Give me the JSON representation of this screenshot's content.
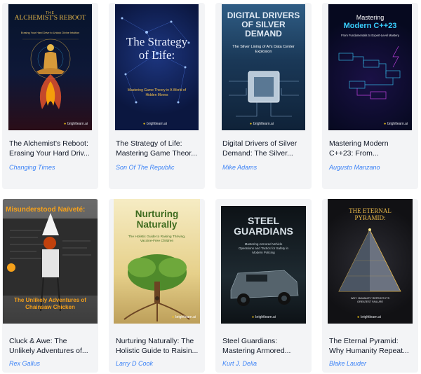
{
  "books": [
    {
      "title_l1": "The Alchemist's Reboot:",
      "title_l2": "Erasing Your Hard Driv...",
      "author": "Changing Times",
      "cover": {
        "top": "THE",
        "main": "ALCHEMIST'S REBOOT",
        "sub": "Erasing Your Hard Drive to Unlock Divine Intuition",
        "brand": "brightlearn.ai",
        "colors": {
          "bg1": "#07142b",
          "bg2": "#1c0d24",
          "accent": "#e9b949",
          "fire": "#e2512b"
        }
      }
    },
    {
      "title_l1": "The Strategy of Life:",
      "title_l2": "Mastering Game Theor...",
      "author": "Son Of The Republic",
      "cover": {
        "main": "The Strategy of Life:",
        "sub": "Mastering Game Theory in A World of Hidden Moves",
        "brand": "brightlearn.ai",
        "colors": {
          "bg1": "#0b1740",
          "bg2": "#11255e",
          "accent": "#f5c24a"
        }
      }
    },
    {
      "title_l1": "Digital Drivers of Silver",
      "title_l2": "Demand: The Silver...",
      "author": "Mike Adams",
      "cover": {
        "main": "DIGITAL DRIVERS OF SILVER DEMAND",
        "sub": "The Silver Lining of AI's Data Center Explosion",
        "brand": "brightlearn.ai",
        "colors": {
          "bg1": "#0f2238",
          "bg2": "#2f5d85",
          "accent": "#c7d8ea"
        }
      }
    },
    {
      "title_l1": "Mastering Modern",
      "title_l2": "C++23: From...",
      "author": "Augusto Manzano",
      "cover": {
        "top": "Mastering",
        "main": "Modern C++23",
        "sub": "From Fundamentals to Expert-Level Mastery",
        "brand": "brightlearn.ai",
        "colors": {
          "bg1": "#06091f",
          "bg2": "#1a1146",
          "accent": "#39d0ff",
          "accent2": "#e04bff"
        }
      }
    },
    {
      "title_l1": "Cluck & Awe: The",
      "title_l2": "Unlikely Adventures of...",
      "author": "Rex Gallus",
      "cover": {
        "main": "Misunderstood Naïveté:",
        "sub": "The Unlikely Adventures of Chainsaw Chicken",
        "colors": {
          "bg1": "#2d2d2d",
          "bg2": "#6b6b6b",
          "accent": "#f6a11a"
        }
      }
    },
    {
      "title_l1": "Nurturing Naturally: The",
      "title_l2": "Holistic Guide to Raisin...",
      "author": "Larry D Cook",
      "cover": {
        "main": "Nurturing Naturally",
        "sub": "The Holistic Guide to Raising Thriving, Vaccine-Free Children",
        "brand": "brightlearn.ai",
        "colors": {
          "bg1": "#f4e7b8",
          "bg2": "#d7c277",
          "accent": "#3e6b1f"
        }
      }
    },
    {
      "title_l1": "Steel Guardians:",
      "title_l2": "Mastering Armored...",
      "author": "Kurt J. Delia",
      "cover": {
        "main": "STEEL GUARDIANS",
        "sub": "Mastering Armored Vehicle Operations and Tactics for Safety in Modern Policing",
        "brand": "brightlearn.ai",
        "colors": {
          "bg1": "#0d1216",
          "bg2": "#2b3a42",
          "accent": "#d9e2e8"
        }
      }
    },
    {
      "title_l1": "The Eternal Pyramid:",
      "title_l2": "Why Humanity Repeat...",
      "author": "Blake Lauder",
      "cover": {
        "main": "THE ETERNAL PYRAMID:",
        "sub": "WHY HUMANITY REPEATS ITS GREATEST FAILURE",
        "brand": "brightlearn.ai",
        "colors": {
          "bg1": "#111114",
          "bg2": "#2c2c33",
          "accent": "#e9b949"
        }
      }
    }
  ]
}
